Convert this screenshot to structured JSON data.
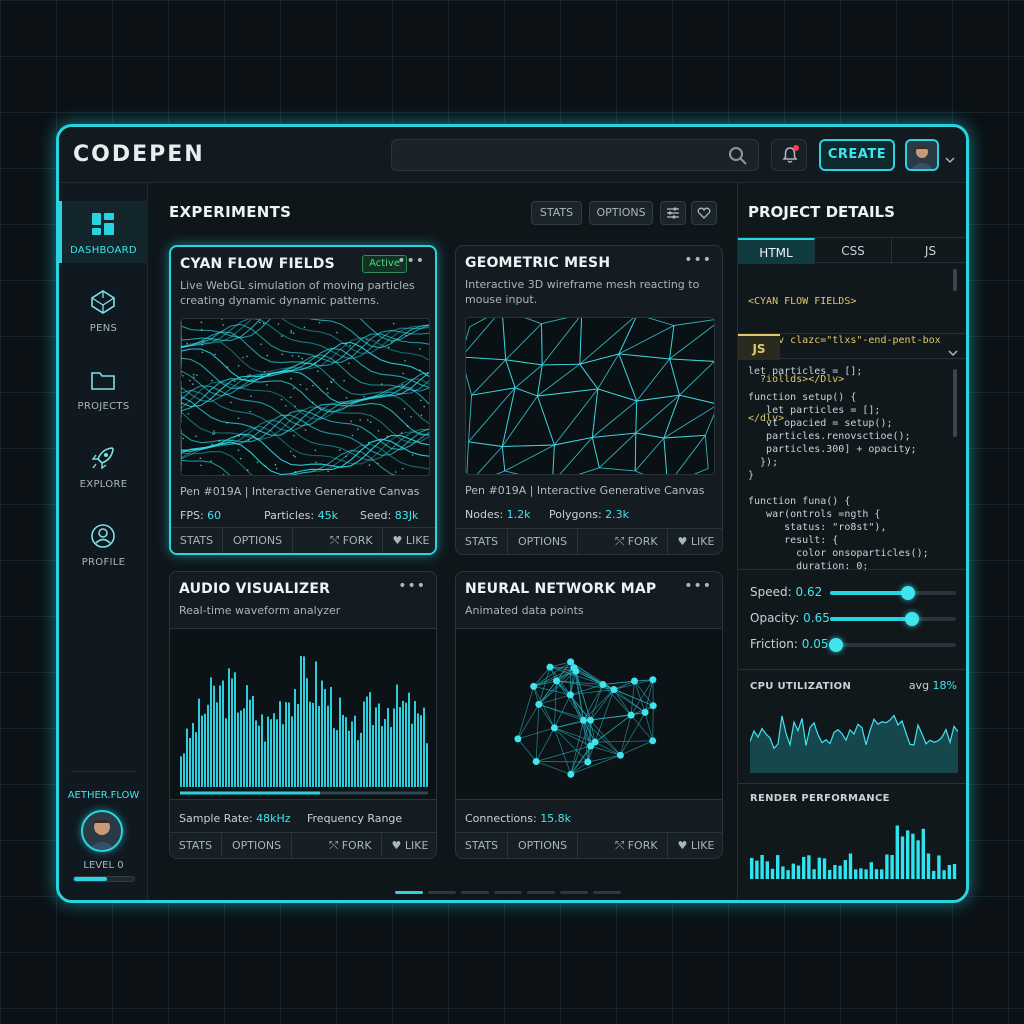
{
  "header": {
    "logo": "CODEPEN",
    "search_placeholder": "",
    "create_label": "CREATE"
  },
  "sidebar": {
    "items": [
      {
        "label": "DASHBOARD",
        "icon": "dashboard-icon",
        "active": true
      },
      {
        "label": "PENS",
        "icon": "pen-cube-icon"
      },
      {
        "label": "PROJECTS",
        "icon": "folder-icon"
      },
      {
        "label": "EXPLORE",
        "icon": "rocket-icon"
      },
      {
        "label": "PROFILE",
        "icon": "user-icon"
      }
    ],
    "user": {
      "name": "AETHER.FLOW",
      "level": "LEVEL 0",
      "level_progress": 0.55
    }
  },
  "main": {
    "title": "EXPERIMENTS",
    "top_buttons": {
      "stats": "STATS",
      "options": "OPTIONS"
    },
    "cards": [
      {
        "title": "CYAN FLOW FIELDS",
        "badge": "Active",
        "desc": "Live WebGL simulation of moving particles creating dynamic dynamic patterns.",
        "meta": "Pen #019A |  Interactive Generative Canvas",
        "stats": [
          {
            "label": "FPS:",
            "value": "60"
          },
          {
            "label": "Particles:",
            "value": "45k"
          },
          {
            "label": "Seed:",
            "value": "83Jk"
          }
        ],
        "foot": {
          "stats": "STATS",
          "options": "OPTIONS",
          "fork": "FORK",
          "like": "LIKE"
        }
      },
      {
        "title": "GEOMETRIC MESH",
        "desc": "Interactive 3D wireframe mesh reacting to mouse input.",
        "meta": "Pen #019A |  Interactive Generative Canvas",
        "stats": [
          {
            "label": "Nodes:",
            "value": "1.2k"
          },
          {
            "label": "Polygons:",
            "value": "2.3k"
          }
        ],
        "foot": {
          "stats": "STATS",
          "options": "OPTIONS",
          "fork": "FORK",
          "like": "LIKE"
        }
      },
      {
        "title": "AUDIO VISUALIZER",
        "desc": "Real-time waveform analyzer",
        "stats": [
          {
            "label": "Sample Rate:",
            "value": "48kHz"
          },
          {
            "label": "Frequency Range",
            "value": ""
          }
        ],
        "foot": {
          "stats": "STATS",
          "options": "OPTIONS",
          "fork": "FORK",
          "like": "LIKE"
        }
      },
      {
        "title": "NEURAL NETWORK MAP",
        "desc": "Animated data points",
        "stats": [
          {
            "label": "Connections:",
            "value": "15.8k"
          }
        ],
        "foot": {
          "stats": "STATS",
          "options": "OPTIONS",
          "fork": "FORK",
          "like": "LIKE"
        }
      }
    ]
  },
  "details": {
    "title": "PROJECT DETAILS",
    "tabs": [
      "HTML",
      "CSS",
      "JS"
    ],
    "html_code": [
      "<CYAN FLOW FIELDS>",
      "  <div clazc=\"tlxs\"-end-pent-box",
      "  ?iollds></Dlv>",
      "</dlv>"
    ],
    "js_tab": "JS",
    "js_code": [
      "let particles = [];",
      "",
      "function setup() {",
      "   let particles = [];",
      "   vt opacied = setup();",
      "   particles.renovsctioe();",
      "   particles.300] + opacity;",
      "  });",
      "}",
      "",
      "function funa() {",
      "   war(ontrols =ngth {",
      "      status: \"ro8st\"),",
      "      result: {",
      "        color onsoparticles();",
      "        duration: 0;"
    ],
    "sliders": [
      {
        "label": "Speed:",
        "value": "0.62",
        "fraction": 0.62
      },
      {
        "label": "Opacity:",
        "value": "0.65",
        "fraction": 0.65
      },
      {
        "label": "Friction:",
        "value": "0.05",
        "fraction": 0.05
      }
    ],
    "cpu": {
      "title": "CPU UTILIZATION",
      "avg_label": "avg",
      "avg_value": "18%"
    },
    "render": {
      "title": "RENDER PERFORMANCE"
    }
  },
  "colors": {
    "accent": "#27d4e0",
    "active_badge": "#4fd88a",
    "alert": "#ff3b4c"
  }
}
